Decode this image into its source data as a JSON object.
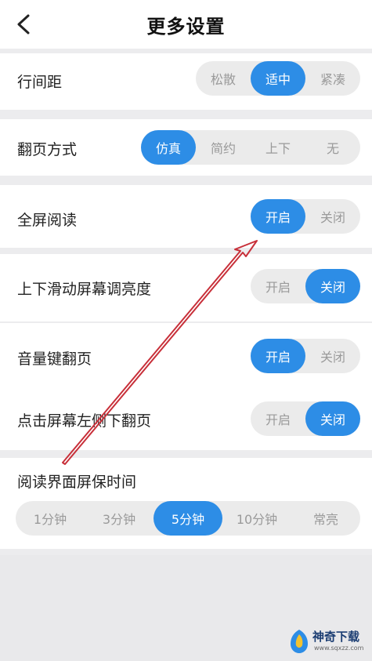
{
  "header": {
    "title": "更多设置",
    "back_icon": "chevron-left-icon"
  },
  "colors": {
    "accent": "#2d8de6",
    "annotation_arrow": "#c8303a"
  },
  "settings": {
    "line_spacing": {
      "label": "行间距",
      "options": [
        "松散",
        "适中",
        "紧凑"
      ],
      "selected": "适中"
    },
    "page_turn": {
      "label": "翻页方式",
      "options": [
        "仿真",
        "简约",
        "上下",
        "无"
      ],
      "selected": "仿真"
    },
    "fullscreen": {
      "label": "全屏阅读",
      "options": [
        "开启",
        "关闭"
      ],
      "selected": "开启"
    },
    "swipe_brightness": {
      "label": "上下滑动屏幕调亮度",
      "options": [
        "开启",
        "关闭"
      ],
      "selected": "关闭"
    },
    "volume_key_turn": {
      "label": "音量键翻页",
      "options": [
        "开启",
        "关闭"
      ],
      "selected": "开启"
    },
    "tap_left_turn": {
      "label": "点击屏幕左侧下翻页",
      "options": [
        "开启",
        "关闭"
      ],
      "selected": "关闭"
    },
    "screensaver": {
      "label": "阅读界面屏保时间",
      "options": [
        "1分钟",
        "3分钟",
        "5分钟",
        "10分钟",
        "常亮"
      ],
      "selected": "5分钟"
    }
  },
  "watermark": {
    "name": "神奇下载",
    "url": "www.sqxzz.com"
  }
}
